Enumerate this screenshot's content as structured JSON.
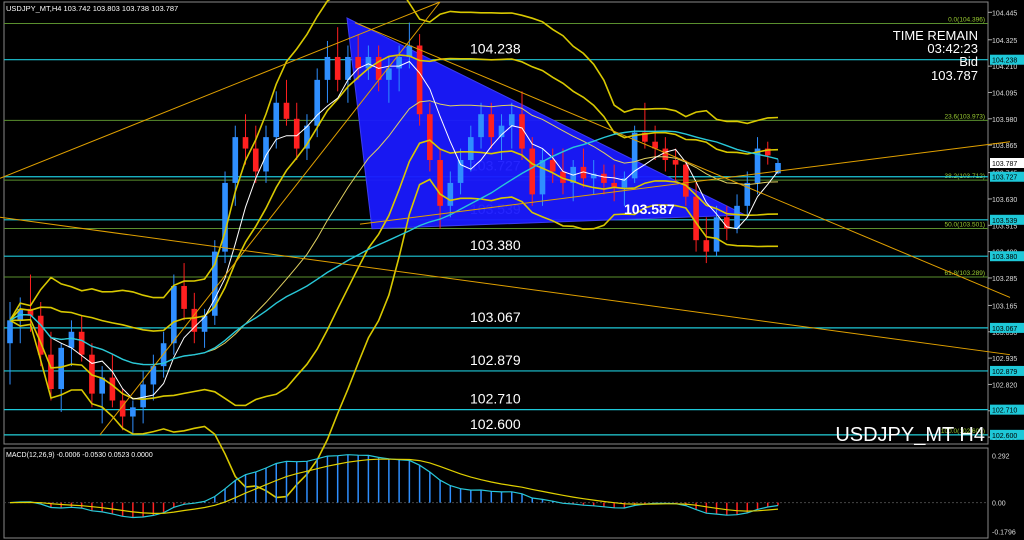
{
  "chart_data": {
    "type": "candlestick",
    "header": "USDJPY_MT,H4  103.742 103.803 103.738 103.787",
    "symbol_label": "USDJPY_MT H4",
    "info": {
      "title": "TIME REMAIN",
      "time": "03:42:23",
      "side": "Bid",
      "price": "103.787"
    },
    "price_axis": {
      "min": 102.56,
      "max": 104.49,
      "ticks": [
        "104.445",
        "104.325",
        "104.210",
        "104.095",
        "103.980",
        "103.865",
        "103.745",
        "103.630",
        "103.515",
        "103.400",
        "103.285",
        "103.165",
        "103.050",
        "102.935",
        "102.820",
        "102.705",
        "102.590"
      ]
    },
    "levels": [
      {
        "value": 104.238,
        "label": "104.238"
      },
      {
        "value": 103.727,
        "label": "103.727"
      },
      {
        "value": 103.539,
        "label": "103.539"
      },
      {
        "value": 103.38,
        "label": "103.380"
      },
      {
        "value": 103.067,
        "label": "103.067"
      },
      {
        "value": 102.879,
        "label": "102.879"
      },
      {
        "value": 102.71,
        "label": "102.710"
      },
      {
        "value": 102.6,
        "label": "102.600"
      }
    ],
    "current_price": {
      "value": 103.587,
      "label": "103.587"
    },
    "last_price_tag": "103.787",
    "fibonacci": [
      {
        "value": 104.396,
        "label": "0.0(104.396)"
      },
      {
        "value": 103.973,
        "label": "23.6(103.973)"
      },
      {
        "value": 103.712,
        "label": "38.2(103.712)"
      },
      {
        "value": 103.501,
        "label": "50.0(103.501)"
      },
      {
        "value": 103.289,
        "label": "61.8(103.289)"
      },
      {
        "value": 102.6,
        "label": "100.0(102.600)"
      }
    ],
    "candles": [
      [
        103.0,
        103.18,
        102.82,
        103.1
      ],
      [
        103.1,
        103.2,
        103.0,
        103.15
      ],
      [
        103.15,
        103.3,
        103.05,
        103.12
      ],
      [
        103.12,
        103.18,
        102.9,
        102.95
      ],
      [
        102.95,
        103.05,
        102.75,
        102.8
      ],
      [
        102.8,
        103.0,
        102.7,
        102.98
      ],
      [
        102.98,
        103.1,
        102.9,
        103.05
      ],
      [
        103.05,
        103.12,
        102.92,
        102.95
      ],
      [
        102.95,
        103.0,
        102.72,
        102.78
      ],
      [
        102.78,
        102.9,
        102.65,
        102.85
      ],
      [
        102.85,
        102.95,
        102.72,
        102.75
      ],
      [
        102.75,
        102.8,
        102.62,
        102.68
      ],
      [
        102.68,
        102.75,
        102.6,
        102.72
      ],
      [
        102.72,
        102.88,
        102.65,
        102.82
      ],
      [
        102.82,
        102.95,
        102.75,
        102.9
      ],
      [
        102.9,
        103.05,
        102.85,
        103.0
      ],
      [
        103.0,
        103.3,
        102.95,
        103.25
      ],
      [
        103.25,
        103.35,
        103.1,
        103.15
      ],
      [
        103.15,
        103.22,
        103.0,
        103.05
      ],
      [
        103.05,
        103.15,
        102.98,
        103.12
      ],
      [
        103.12,
        103.45,
        103.08,
        103.4
      ],
      [
        103.4,
        103.75,
        103.35,
        103.7
      ],
      [
        103.7,
        103.95,
        103.6,
        103.9
      ],
      [
        103.9,
        104.0,
        103.78,
        103.85
      ],
      [
        103.85,
        103.95,
        103.7,
        103.75
      ],
      [
        103.75,
        103.95,
        103.7,
        103.9
      ],
      [
        103.9,
        104.1,
        103.85,
        104.05
      ],
      [
        104.05,
        104.15,
        103.95,
        103.98
      ],
      [
        103.98,
        104.05,
        103.8,
        103.85
      ],
      [
        103.85,
        104.0,
        103.8,
        103.95
      ],
      [
        103.95,
        104.2,
        103.9,
        104.15
      ],
      [
        104.15,
        104.32,
        104.05,
        104.25
      ],
      [
        104.25,
        104.38,
        104.1,
        104.15
      ],
      [
        104.15,
        104.3,
        104.05,
        104.25
      ],
      [
        104.25,
        104.35,
        104.15,
        104.2
      ],
      [
        104.2,
        104.3,
        104.15,
        104.25
      ],
      [
        104.25,
        104.3,
        104.1,
        104.15
      ],
      [
        104.15,
        104.25,
        104.05,
        104.2
      ],
      [
        104.2,
        104.3,
        104.1,
        104.25
      ],
      [
        104.25,
        104.4,
        104.2,
        104.3
      ],
      [
        104.3,
        104.35,
        103.95,
        104.0
      ],
      [
        104.0,
        104.05,
        103.75,
        103.8
      ],
      [
        103.8,
        103.85,
        103.5,
        103.6
      ],
      [
        103.6,
        103.75,
        103.55,
        103.7
      ],
      [
        103.7,
        103.85,
        103.65,
        103.8
      ],
      [
        103.8,
        103.95,
        103.75,
        103.9
      ],
      [
        103.9,
        104.05,
        103.85,
        104.0
      ],
      [
        104.0,
        104.05,
        103.85,
        103.9
      ],
      [
        103.9,
        104.0,
        103.8,
        103.95
      ],
      [
        103.95,
        104.05,
        103.85,
        104.0
      ],
      [
        104.0,
        104.1,
        103.8,
        103.85
      ],
      [
        103.85,
        103.9,
        103.6,
        103.65
      ],
      [
        103.65,
        103.85,
        103.6,
        103.8
      ],
      [
        103.8,
        103.85,
        103.7,
        103.75
      ],
      [
        103.75,
        103.85,
        103.65,
        103.7
      ],
      [
        103.7,
        103.8,
        103.62,
        103.77
      ],
      [
        103.77,
        103.85,
        103.68,
        103.72
      ],
      [
        103.72,
        103.8,
        103.65,
        103.74
      ],
      [
        103.74,
        103.78,
        103.65,
        103.7
      ],
      [
        103.7,
        103.78,
        103.62,
        103.68
      ],
      [
        103.68,
        103.75,
        103.6,
        103.72
      ],
      [
        103.72,
        103.95,
        103.7,
        103.92
      ],
      [
        103.92,
        104.05,
        103.85,
        103.88
      ],
      [
        103.88,
        103.95,
        103.8,
        103.85
      ],
      [
        103.85,
        103.9,
        103.75,
        103.8
      ],
      [
        103.8,
        103.85,
        103.7,
        103.78
      ],
      [
        103.78,
        103.8,
        103.6,
        103.64
      ],
      [
        103.64,
        103.7,
        103.4,
        103.45
      ],
      [
        103.45,
        103.55,
        103.35,
        103.4
      ],
      [
        103.4,
        103.6,
        103.38,
        103.55
      ],
      [
        103.55,
        103.6,
        103.45,
        103.5
      ],
      [
        103.5,
        103.65,
        103.48,
        103.6
      ],
      [
        103.6,
        103.75,
        103.55,
        103.7
      ],
      [
        103.7,
        103.9,
        103.65,
        103.85
      ],
      [
        103.85,
        103.88,
        103.78,
        103.82
      ],
      [
        103.742,
        103.803,
        103.738,
        103.787
      ]
    ],
    "macd": {
      "label": "MACD(12,26,9) -0.0006 -0.0530 0.0523 0.0000",
      "ylim": [
        -0.22,
        0.34
      ],
      "ticks": [
        "0.292",
        "0.00",
        "-0.1796"
      ]
    }
  }
}
